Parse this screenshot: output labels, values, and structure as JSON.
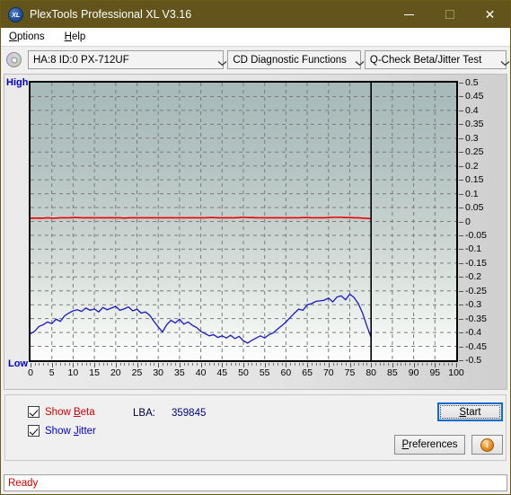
{
  "window": {
    "title": "PlexTools Professional XL V3.16",
    "logo_text": "XL",
    "controls": {
      "minimize": "—",
      "maximize": "□",
      "close": "✕"
    }
  },
  "menubar": {
    "items": [
      "Options",
      "Help"
    ]
  },
  "toolbar": {
    "drive_icon": "disc-icon",
    "drive_select": "HA:8 ID:0  PX-712UF",
    "function_select": "CD Diagnostic Functions",
    "test_select": "Q-Check Beta/Jitter Test"
  },
  "chart_axis": {
    "left_high": "High",
    "left_low": "Low"
  },
  "controls": {
    "show_beta_label": "Show Beta",
    "show_jitter_label": "Show Jitter",
    "show_beta_checked": true,
    "show_jitter_checked": true,
    "lba_label": "LBA:",
    "lba_value": "359845",
    "start_label": "Start",
    "preferences_label": "Preferences",
    "info_label": "i"
  },
  "statusbar": {
    "text": "Ready"
  },
  "colors": {
    "titlebar": "#63541c",
    "beta_line": "#ee0000",
    "jitter_line": "#1818c8",
    "accent_focus": "#0b6bd4",
    "label_blue": "#0000cc",
    "status_red": "#dd0000"
  },
  "chart_data": {
    "type": "line",
    "title": "Q-Check Beta/Jitter Test",
    "xlabel": "",
    "ylabel": "",
    "xlim": [
      0,
      100
    ],
    "ylim": [
      -0.5,
      0.5
    ],
    "xticks": [
      0,
      5,
      10,
      15,
      20,
      25,
      30,
      35,
      40,
      45,
      50,
      55,
      60,
      65,
      70,
      75,
      80,
      85,
      90,
      95,
      100
    ],
    "yticks": [
      0.5,
      0.45,
      0.4,
      0.35,
      0.3,
      0.25,
      0.2,
      0.15,
      0.1,
      0.05,
      0,
      -0.05,
      -0.1,
      -0.15,
      -0.2,
      -0.25,
      -0.3,
      -0.35,
      -0.4,
      -0.45,
      -0.5
    ],
    "grid": true,
    "legend": [
      "Show Beta",
      "Show Jitter"
    ],
    "annotations": [
      {
        "type": "vline",
        "x": 80,
        "label": "data end marker",
        "color": "#000000"
      }
    ],
    "series": [
      {
        "name": "Beta",
        "color": "#ee0000",
        "x": [
          0,
          1,
          2,
          3,
          4,
          5,
          6,
          7,
          8,
          9,
          10,
          11,
          12,
          13,
          14,
          15,
          16,
          17,
          18,
          19,
          20,
          21,
          22,
          23,
          24,
          25,
          26,
          27,
          28,
          29,
          30,
          31,
          32,
          33,
          34,
          35,
          36,
          37,
          38,
          39,
          40,
          41,
          42,
          43,
          44,
          45,
          46,
          47,
          48,
          49,
          50,
          51,
          52,
          53,
          54,
          55,
          56,
          57,
          58,
          59,
          60,
          61,
          62,
          63,
          64,
          65,
          66,
          67,
          68,
          69,
          70,
          71,
          72,
          73,
          74,
          75,
          76,
          77,
          78,
          79,
          80
        ],
        "values": [
          0.012,
          0.012,
          0.012,
          0.012,
          0.013,
          0.012,
          0.012,
          0.013,
          0.013,
          0.013,
          0.014,
          0.014,
          0.013,
          0.013,
          0.013,
          0.013,
          0.013,
          0.013,
          0.013,
          0.013,
          0.013,
          0.013,
          0.012,
          0.013,
          0.013,
          0.013,
          0.013,
          0.013,
          0.013,
          0.013,
          0.013,
          0.013,
          0.013,
          0.013,
          0.013,
          0.013,
          0.013,
          0.013,
          0.013,
          0.013,
          0.013,
          0.013,
          0.014,
          0.014,
          0.013,
          0.013,
          0.013,
          0.013,
          0.013,
          0.014,
          0.015,
          0.014,
          0.014,
          0.013,
          0.013,
          0.013,
          0.013,
          0.013,
          0.013,
          0.013,
          0.013,
          0.013,
          0.013,
          0.013,
          0.014,
          0.014,
          0.013,
          0.013,
          0.013,
          0.013,
          0.014,
          0.015,
          0.015,
          0.015,
          0.014,
          0.014,
          0.013,
          0.013,
          0.012,
          0.011,
          0.01
        ]
      },
      {
        "name": "Jitter",
        "color": "#1818c8",
        "x": [
          0,
          1,
          2,
          3,
          4,
          5,
          6,
          7,
          8,
          9,
          10,
          11,
          12,
          13,
          14,
          15,
          16,
          17,
          18,
          19,
          20,
          21,
          22,
          23,
          24,
          25,
          26,
          27,
          28,
          29,
          30,
          31,
          32,
          33,
          34,
          35,
          36,
          37,
          38,
          39,
          40,
          41,
          42,
          43,
          44,
          45,
          46,
          47,
          48,
          49,
          50,
          51,
          52,
          53,
          54,
          55,
          56,
          57,
          58,
          59,
          60,
          61,
          62,
          63,
          64,
          65,
          66,
          67,
          68,
          69,
          70,
          71,
          72,
          73,
          74,
          75,
          76,
          77,
          78,
          79,
          80
        ],
        "values": [
          -0.405,
          -0.395,
          -0.378,
          -0.372,
          -0.362,
          -0.368,
          -0.352,
          -0.36,
          -0.34,
          -0.33,
          -0.322,
          -0.318,
          -0.324,
          -0.312,
          -0.32,
          -0.315,
          -0.326,
          -0.31,
          -0.318,
          -0.312,
          -0.306,
          -0.32,
          -0.315,
          -0.308,
          -0.322,
          -0.316,
          -0.33,
          -0.326,
          -0.338,
          -0.36,
          -0.38,
          -0.398,
          -0.372,
          -0.356,
          -0.366,
          -0.352,
          -0.37,
          -0.362,
          -0.374,
          -0.382,
          -0.396,
          -0.404,
          -0.412,
          -0.408,
          -0.418,
          -0.412,
          -0.42,
          -0.41,
          -0.422,
          -0.414,
          -0.43,
          -0.438,
          -0.428,
          -0.42,
          -0.412,
          -0.42,
          -0.408,
          -0.402,
          -0.388,
          -0.376,
          -0.362,
          -0.346,
          -0.33,
          -0.316,
          -0.32,
          -0.3,
          -0.296,
          -0.288,
          -0.286,
          -0.284,
          -0.276,
          -0.29,
          -0.272,
          -0.268,
          -0.282,
          -0.262,
          -0.274,
          -0.296,
          -0.33,
          -0.376,
          -0.418
        ]
      }
    ]
  }
}
